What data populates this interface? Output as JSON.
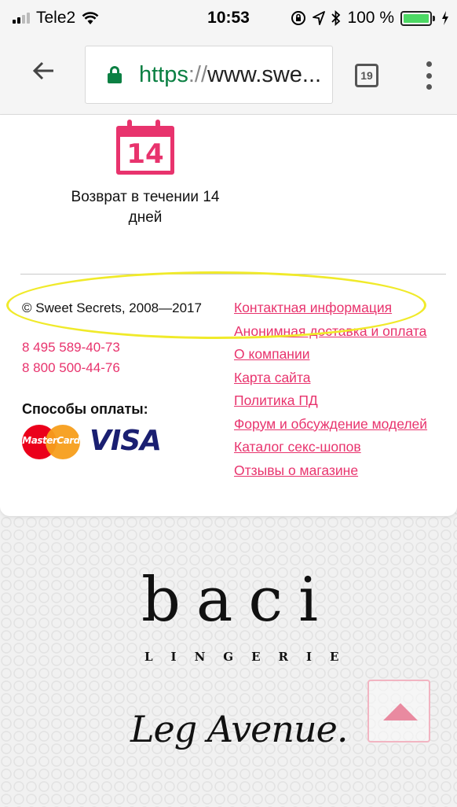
{
  "status_bar": {
    "carrier": "Tele2",
    "time": "10:53",
    "battery_percent": "100 %",
    "icons": [
      "signal-icon",
      "wifi-icon",
      "orientation-lock-icon",
      "location-icon",
      "bluetooth-icon",
      "battery-icon",
      "charging-icon"
    ]
  },
  "browser": {
    "url_scheme": "https",
    "url_separator": "://",
    "url_rest": "www.swe...",
    "tab_count": "19",
    "icons": [
      "back-arrow-icon",
      "lock-icon",
      "tabs-icon",
      "more-vert-icon"
    ]
  },
  "page": {
    "return_policy": {
      "calendar_number": "14",
      "line1": "Возврат в течении 14",
      "line2": "дней"
    },
    "copyright": "© Sweet Secrets, 2008—2017",
    "phones": [
      "8 495 589-40-73",
      "8 800 500-44-76"
    ],
    "payment_title": "Способы оплаты:",
    "payment_logos": {
      "mastercard": "MasterCard",
      "visa": "VISA"
    },
    "footer_links": [
      {
        "label": "Контактная информация"
      },
      {
        "label": "Анонимная доставка и оплата"
      },
      {
        "label": "О компании"
      },
      {
        "label": "Карта сайта"
      },
      {
        "label": "Политика ПД"
      },
      {
        "label": "Форум и обсуждение моделей"
      },
      {
        "label": "Каталог секс-шопов"
      },
      {
        "label": "Отзывы о магазине"
      }
    ],
    "brands": {
      "baci": "baci",
      "baci_sub": "LINGERIE",
      "leg_avenue": "Leg Avenue."
    }
  },
  "colors": {
    "accent": "#e8336d",
    "secure_green": "#0b8043",
    "highlight_annotation": "#f0ea2a",
    "battery_green": "#4cd964"
  }
}
